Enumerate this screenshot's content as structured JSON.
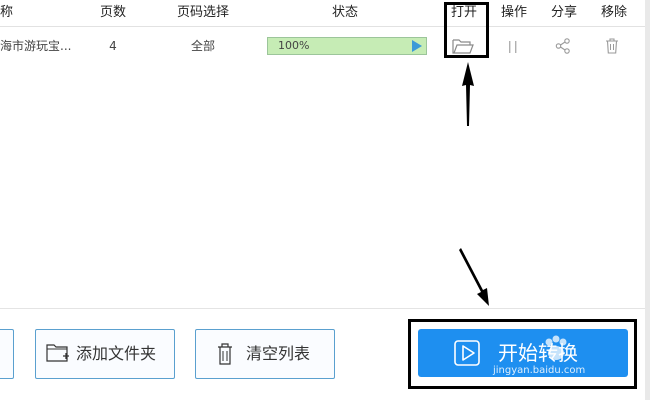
{
  "table": {
    "columns": [
      "称",
      "页数",
      "页码选择",
      "状态",
      "打开",
      "操作",
      "分享",
      "移除"
    ],
    "rows": [
      {
        "name": "海市游玩宝...",
        "pages": "4",
        "page_selection": "全部",
        "status_text": "100%",
        "progress": 1.0
      }
    ]
  },
  "icons": {
    "open": "folder-open-icon",
    "operate": "pause-icon",
    "share": "share-icon",
    "remove": "trash-icon",
    "play": "play-icon",
    "add_folder": "folder-add-icon",
    "clear_list": "trash-icon"
  },
  "buttons": {
    "add_folder": "添加文件夹",
    "clear_list": "清空列表",
    "start": "开始转换"
  },
  "watermark": {
    "text": "jingyan.baidu.com"
  },
  "colors": {
    "accent": "#1e8ff0",
    "progress_fill": "#c6ecb5",
    "progress_border": "#9cc59a",
    "button_border": "#5aa0cf",
    "highlight": "#000000"
  }
}
